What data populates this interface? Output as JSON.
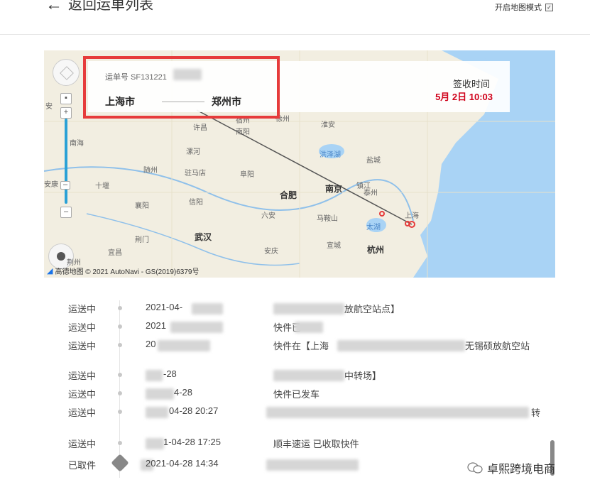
{
  "header": {
    "back_label": "返回运单列表",
    "map_mode_label": "开启地图模式",
    "map_mode_checked": "✓"
  },
  "map": {
    "waybill_label": "运单号 SF131221",
    "origin": "上海市",
    "destination": "郑州市",
    "sign_label": "签收时间",
    "sign_time": "5月 2日 10:03",
    "attribution": "高德地图 © 2021 AutoNavi - GS(2019)6379号",
    "cities": [
      "安",
      "南海",
      "安康",
      "十堰",
      "襄阳",
      "荆门",
      "宜昌",
      "荆州",
      "信阳",
      "随州",
      "武汉",
      "驻马店",
      "漯河",
      "许昌",
      "南阳",
      "阜阳",
      "合肥",
      "六安",
      "安庆",
      "南京",
      "镇江",
      "泰州",
      "盐城",
      "上海",
      "太湖",
      "杭州",
      "宣城",
      "马鞍山",
      "宿州",
      "洪泽湖",
      "淮安",
      "徐州"
    ],
    "accent": "#e63b3b"
  },
  "timeline": [
    {
      "status": "运送中",
      "time": "2021-04-",
      "desc": "放航空站点】"
    },
    {
      "status": "运送中",
      "time": "2021",
      "desc": "快件已"
    },
    {
      "status": "运送中",
      "time": "20",
      "desc": "快件在【上海",
      "desc_tail": "无锡硕放航空站"
    },
    {
      "status": "运送中",
      "time": "-28",
      "desc": "中转场】"
    },
    {
      "status": "运送中",
      "time": "4-28",
      "desc": "快件已发车"
    },
    {
      "status": "运送中",
      "time": "04-28 20:27",
      "desc": "",
      "desc_tail": "转"
    },
    {
      "status": "运送中",
      "time": "1-04-28 17:25",
      "desc": "顺丰速运 已收取快件"
    },
    {
      "status": "已取件",
      "time": "2021-04-28 14:34",
      "desc": ""
    }
  ],
  "watermark": "卓熙跨境电商"
}
